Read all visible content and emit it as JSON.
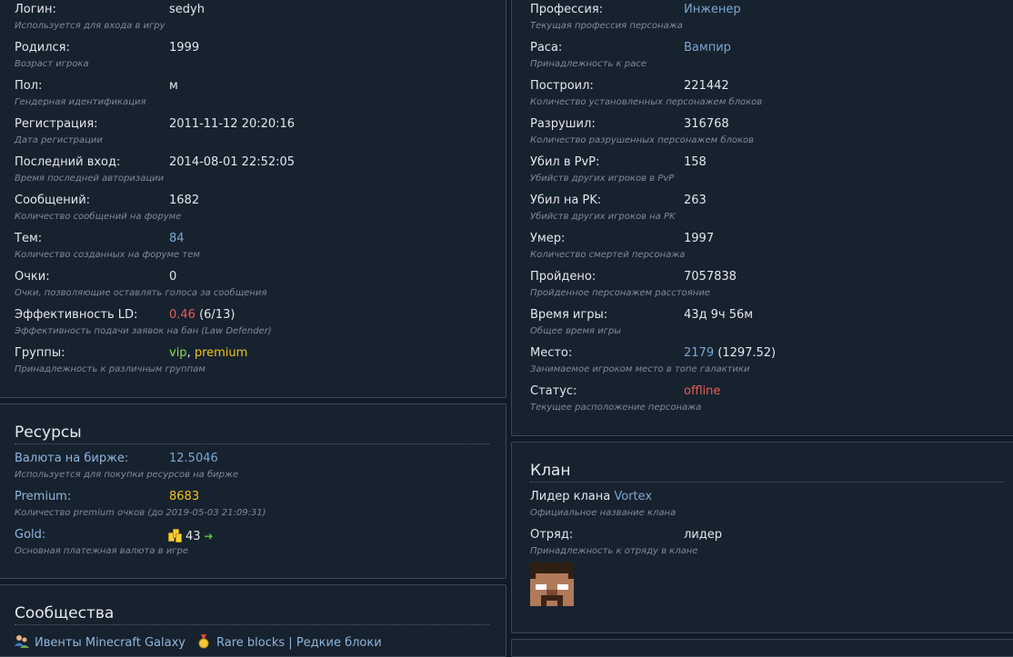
{
  "profile_left": [
    {
      "label": "Логин:",
      "value": "sedyh",
      "desc": "Используется для входа в игру"
    },
    {
      "label": "Родился:",
      "value": "1999",
      "desc": "Возраст игрока"
    },
    {
      "label": "Пол:",
      "value": "м",
      "desc": "Гендерная идентификация"
    },
    {
      "label": "Регистрация:",
      "value": "2011-11-12 20:20:16",
      "desc": "Дата регистрации"
    },
    {
      "label": "Последний вход:",
      "value": "2014-08-01 22:52:05",
      "desc": "Время последней авторизации"
    },
    {
      "label": "Сообщений:",
      "value": "1682",
      "desc": "Количество сообщений на форуме"
    },
    {
      "label": "Тем:",
      "value": "84",
      "desc": "Количество созданных на форуме тем"
    },
    {
      "label": "Очки:",
      "value": "0",
      "desc": "Очки, позволяющие оставлять голоса за сообщения"
    },
    {
      "label": "Эффективность LD:",
      "value": "0.46",
      "value_extra": " (6/13)",
      "desc": "Эффективность подачи заявок на бан (Law Defender)"
    },
    {
      "label": "Группы:",
      "value": "vip",
      "value_sep": ", ",
      "value_extra": "premium",
      "desc": "Принадлежность к различным группам"
    }
  ],
  "profile_right": [
    {
      "label": "Профессия:",
      "value": "Инженер",
      "desc": "Текущая профессия персонажа"
    },
    {
      "label": "Раса:",
      "value": "Вампир",
      "desc": "Принадлежность к расе"
    },
    {
      "label": "Построил:",
      "value": "221442",
      "desc": "Количество установленных персонажем блоков"
    },
    {
      "label": "Разрушил:",
      "value": "316768",
      "desc": "Количество разрушенных персонажем блоков"
    },
    {
      "label": "Убил в PvP:",
      "value": "158",
      "desc": "Убийств других игроков в PvP"
    },
    {
      "label": "Убил на PK:",
      "value": "263",
      "desc": "Убийств других игроков на PK"
    },
    {
      "label": "Умер:",
      "value": "1997",
      "desc": "Количество смертей персонажа"
    },
    {
      "label": "Пройдено:",
      "value": "7057838",
      "desc": "Пройденное персонажем расстояние"
    },
    {
      "label": "Время игры:",
      "value": "43д 9ч 56м",
      "desc": "Общее время игры"
    },
    {
      "label": "Место:",
      "value": "2179",
      "value_extra": " (1297.52)",
      "desc": "Занимаемое игроком место в топе галактики"
    },
    {
      "label": "Статус:",
      "value": "offline",
      "desc": "Текущее расположение персонажа"
    }
  ],
  "resources": {
    "title": "Ресурсы",
    "items": [
      {
        "label": "Валюта на бирже:",
        "value": "12.5046",
        "desc": "Используется для покупки ресурсов на бирже"
      },
      {
        "label": "Premium:",
        "value": "8683",
        "desc": "Количество premium очков (до 2019-05-03 21:09:31)"
      },
      {
        "label": "Gold:",
        "value": "43",
        "desc": "Основная платежная валюта в игре"
      }
    ]
  },
  "clan": {
    "title": "Клан",
    "leader_prefix": "Лидер клана ",
    "clan_name": "Vortex",
    "clan_desc": "Официальное название клана",
    "squad_label": "Отряд:",
    "squad_value": "лидер",
    "squad_desc": "Принадлежность к отряду в клане"
  },
  "communities": {
    "title": "Сообщества",
    "items": [
      {
        "label": "Ивенты Minecraft Galaxy",
        "icon": "people-icon"
      },
      {
        "label": "Rare blocks | Редкие блоки",
        "icon": "medal-icon"
      }
    ]
  },
  "colors": {
    "link": "#7aa6cf",
    "offline": "#e85d55",
    "vip": "#8ed84a",
    "premium": "#f0c419"
  }
}
